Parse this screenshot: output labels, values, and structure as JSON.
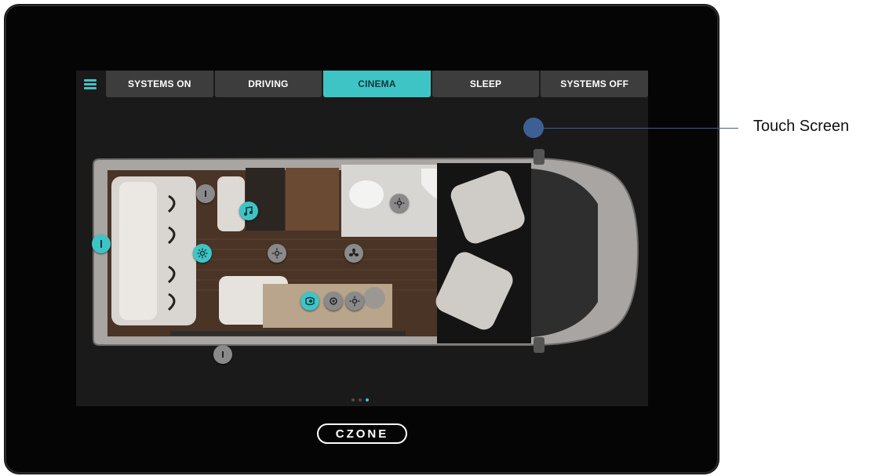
{
  "tabs": [
    {
      "label": "SYSTEMS ON",
      "active": false
    },
    {
      "label": "DRIVING",
      "active": false
    },
    {
      "label": "CINEMA",
      "active": true
    },
    {
      "label": "SLEEP",
      "active": false
    },
    {
      "label": "SYSTEMS OFF",
      "active": false
    }
  ],
  "menu_icon": "hamburger-menu-icon",
  "markers": [
    {
      "name": "info-marker-rear",
      "icon": "info",
      "style": "teal"
    },
    {
      "name": "info-marker-bed",
      "icon": "info",
      "style": "gray"
    },
    {
      "name": "music-marker",
      "icon": "music-note",
      "style": "teal"
    },
    {
      "name": "light-marker-rear",
      "icon": "light",
      "style": "teal"
    },
    {
      "name": "light-marker-floor",
      "icon": "light",
      "style": "gray"
    },
    {
      "name": "fan-marker-floor",
      "icon": "fan",
      "style": "gray"
    },
    {
      "name": "light-marker-bathroom",
      "icon": "light",
      "style": "gray"
    },
    {
      "name": "heater-marker-kitchen",
      "icon": "heater",
      "style": "teal"
    },
    {
      "name": "dial-marker-kitchen",
      "icon": "dial",
      "style": "gray"
    },
    {
      "name": "light-marker-kitchen",
      "icon": "light",
      "style": "gray"
    },
    {
      "name": "info-marker-side",
      "icon": "info",
      "style": "gray"
    }
  ],
  "pager": {
    "pages": 3,
    "current": 3
  },
  "logo": {
    "text": "CZONE"
  },
  "callout": {
    "label": "Touch Screen"
  },
  "colors": {
    "accent": "#3fc4c6",
    "callout": "#3e5f94",
    "tab": "#3d3d3d",
    "screen": "#1a1a1a"
  }
}
